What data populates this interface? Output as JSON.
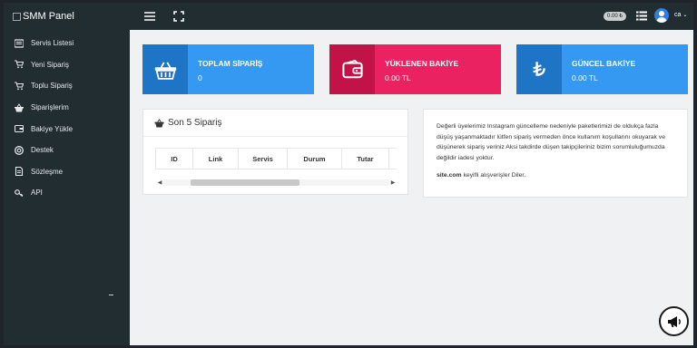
{
  "brand": {
    "name": "SMM Panel"
  },
  "sidebar": {
    "items": [
      {
        "label": "Servis Listesi",
        "icon": "list-icon"
      },
      {
        "label": "Yeni Sipariş",
        "icon": "cart-icon"
      },
      {
        "label": "Toplu Sipariş",
        "icon": "cart-icon"
      },
      {
        "label": "Siparişlerim",
        "icon": "basket-icon"
      },
      {
        "label": "Bakiye Yükle",
        "icon": "wallet-icon"
      },
      {
        "label": "Destek",
        "icon": "lifebuoy-icon"
      },
      {
        "label": "Sözleşme",
        "icon": "document-icon"
      },
      {
        "label": "API",
        "icon": "key-icon"
      }
    ]
  },
  "topbar": {
    "balance": "0.00 ₺",
    "user": "ca"
  },
  "stats": [
    {
      "label": "TOPLAM SİPARİŞ",
      "value": "0",
      "color": "#3598f1",
      "icon": "basket-icon"
    },
    {
      "label": "YÜKLENEN BAKİYE",
      "value": "0.00 TL",
      "color": "#ea2262",
      "icon": "wallet-icon"
    },
    {
      "label": "GÜNCEL BAKİYE",
      "value": "0.00 TL",
      "color": "#3598f1",
      "icon": "lira-icon"
    }
  ],
  "orders": {
    "title": "Son 5 Sipariş",
    "columns": [
      "ID",
      "Link",
      "Servis",
      "Durum",
      "Tutar"
    ]
  },
  "notice": {
    "text": "Değerli üyelerimiz Instagram güncelleme nedeniyle paketlerimizi de oldukça fazla düşüş yaşanmaktadır lütfen sipariş vermeden önce kullanım koşullarını okuyarak ve düşünerek sipariş veriniz Aksi takdirde düşen takipçileriniz bizim sorumluluğumuzda değildir iadesi yoktur.",
    "site": "site.com",
    "closing": " keyifli alışverişler Diler."
  }
}
